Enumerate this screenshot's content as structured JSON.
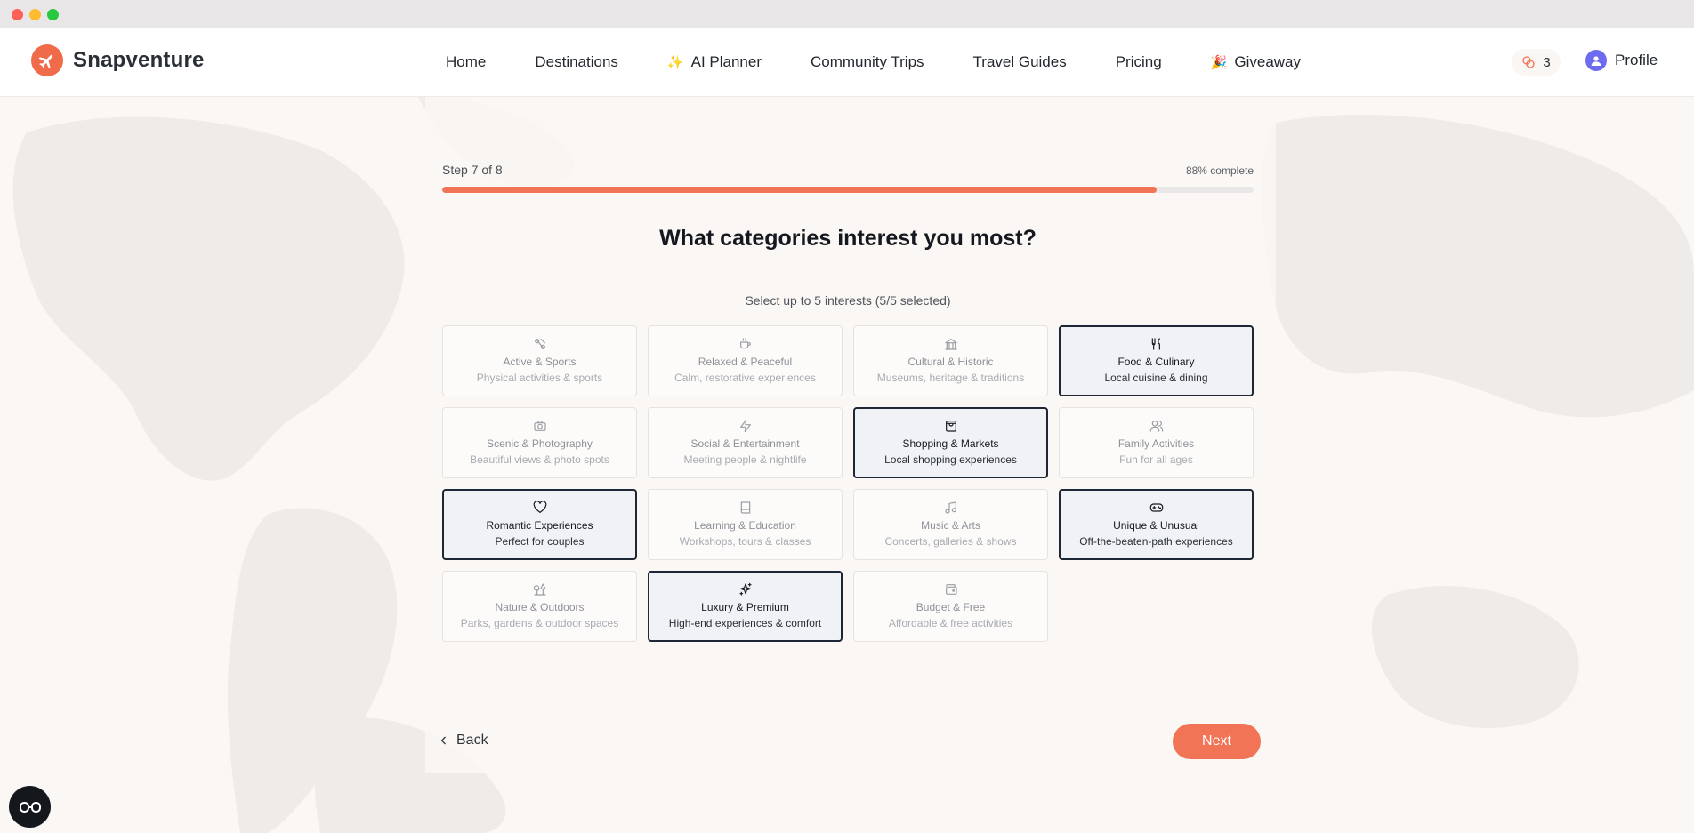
{
  "brand": {
    "name": "Snapventure",
    "accent": "#f27456"
  },
  "nav": {
    "links": [
      {
        "label": "Home"
      },
      {
        "label": "Destinations"
      },
      {
        "label": "AI Planner",
        "emoji": "✨"
      },
      {
        "label": "Community Trips"
      },
      {
        "label": "Travel Guides"
      },
      {
        "label": "Pricing"
      },
      {
        "label": "Giveaway",
        "emoji": "🎉"
      }
    ],
    "points": "3",
    "profile_label": "Profile"
  },
  "wizard": {
    "step_label": "Step 7 of 8",
    "percent_label": "88% complete",
    "progress": 0.88,
    "question": "What categories interest you most?",
    "helper": "Select up to 5 interests (5/5 selected)",
    "categories": [
      {
        "icon": "activity-icon",
        "title": "Active & Sports",
        "desc": "Physical activities & sports",
        "selected": false
      },
      {
        "icon": "coffee-icon",
        "title": "Relaxed & Peaceful",
        "desc": "Calm, restorative experiences",
        "selected": false
      },
      {
        "icon": "landmark-icon",
        "title": "Cultural & Historic",
        "desc": "Museums, heritage & traditions",
        "selected": false
      },
      {
        "icon": "utensils-icon",
        "title": "Food & Culinary",
        "desc": "Local cuisine & dining",
        "selected": true
      },
      {
        "icon": "camera-icon",
        "title": "Scenic & Photography",
        "desc": "Beautiful views & photo spots",
        "selected": false
      },
      {
        "icon": "zap-icon",
        "title": "Social & Entertainment",
        "desc": "Meeting people & nightlife",
        "selected": false
      },
      {
        "icon": "shopping-bag-icon",
        "title": "Shopping & Markets",
        "desc": "Local shopping experiences",
        "selected": true
      },
      {
        "icon": "users-icon",
        "title": "Family Activities",
        "desc": "Fun for all ages",
        "selected": false
      },
      {
        "icon": "heart-icon",
        "title": "Romantic Experiences",
        "desc": "Perfect for couples",
        "selected": true
      },
      {
        "icon": "book-icon",
        "title": "Learning & Education",
        "desc": "Workshops, tours & classes",
        "selected": false
      },
      {
        "icon": "music-icon",
        "title": "Music & Arts",
        "desc": "Concerts, galleries & shows",
        "selected": false
      },
      {
        "icon": "gamepad-icon",
        "title": "Unique & Unusual",
        "desc": "Off-the-beaten-path experiences",
        "selected": true
      },
      {
        "icon": "trees-icon",
        "title": "Nature & Outdoors",
        "desc": "Parks, gardens & outdoor spaces",
        "selected": false
      },
      {
        "icon": "sparkles-icon",
        "title": "Luxury & Premium",
        "desc": "High-end experiences & comfort",
        "selected": true
      },
      {
        "icon": "wallet-icon",
        "title": "Budget & Free",
        "desc": "Affordable & free activities",
        "selected": false
      }
    ],
    "back_label": "Back",
    "next_label": "Next"
  }
}
